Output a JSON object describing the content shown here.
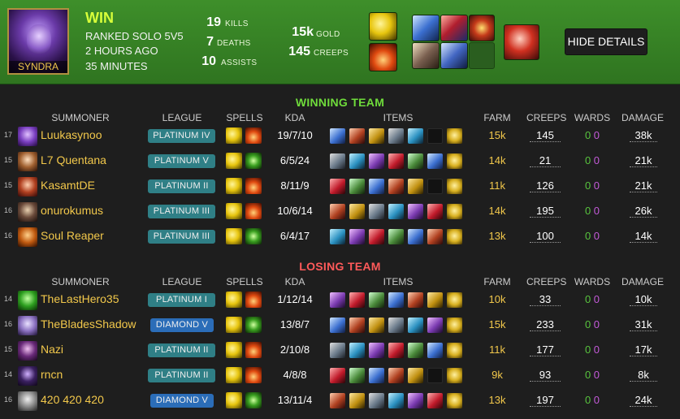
{
  "header": {
    "champion": "SYNDRA",
    "result": "WIN",
    "queue": "RANKED SOLO 5V5",
    "time_ago": "2 HOURS AGO",
    "duration": "35 MINUTES",
    "kills": "19",
    "kills_label": "KILLS",
    "deaths": "7",
    "deaths_label": "DEATHS",
    "assists": "10",
    "assists_label": "ASSISTS",
    "gold": "15k",
    "gold_label": "GOLD",
    "creeps": "145",
    "creeps_label": "CREEPS",
    "hide_details": "HIDE DETAILS",
    "spell_icons": [
      "flash-icon",
      "ignite-icon"
    ],
    "item_icons": [
      "mana-sword-icon",
      "bramble-icon",
      "boots-icon",
      "rod-icon",
      "staff-icon",
      "empty-slot"
    ],
    "trinket_icon": "ward-trinket-icon"
  },
  "columns": {
    "summoner": "SUMMONER",
    "league": "LEAGUE",
    "spells": "SPELLS",
    "kda": "KDA",
    "items": "ITEMS",
    "farm": "FARM",
    "creeps": "CREEPS",
    "wards": "WARDS",
    "damage": "DAMAGE"
  },
  "teams": {
    "winning_title": "WINNING TEAM",
    "losing_title": "LOSING TEAM"
  },
  "winning": [
    {
      "level": "17",
      "name": "Luukasynoo",
      "league": "PLATINUM IV",
      "kda": "19/7/10",
      "farm": "15k",
      "creeps": "145",
      "wards_a": "0",
      "wards_b": "0",
      "damage": "38k"
    },
    {
      "level": "15",
      "name": "L7 Quentana",
      "league": "PLATINUM V",
      "kda": "6/5/24",
      "farm": "14k",
      "creeps": "21",
      "wards_a": "0",
      "wards_b": "0",
      "damage": "21k"
    },
    {
      "level": "15",
      "name": "KasamtDE",
      "league": "PLATINUM II",
      "kda": "8/11/9",
      "farm": "11k",
      "creeps": "126",
      "wards_a": "0",
      "wards_b": "0",
      "damage": "21k"
    },
    {
      "level": "16",
      "name": "onurokumus",
      "league": "PLATINUM III",
      "kda": "10/6/14",
      "farm": "14k",
      "creeps": "195",
      "wards_a": "0",
      "wards_b": "0",
      "damage": "26k"
    },
    {
      "level": "16",
      "name": "Soul Reaper",
      "league": "PLATINUM III",
      "kda": "6/4/17",
      "farm": "13k",
      "creeps": "100",
      "wards_a": "0",
      "wards_b": "0",
      "damage": "14k"
    }
  ],
  "losing": [
    {
      "level": "14",
      "name": "TheLastHero35",
      "league": "PLATINUM I",
      "kda": "1/12/14",
      "farm": "10k",
      "creeps": "33",
      "wards_a": "0",
      "wards_b": "0",
      "damage": "10k"
    },
    {
      "level": "16",
      "name": "TheBladesShadow",
      "league": "DIAMOND V",
      "kda": "13/8/7",
      "farm": "15k",
      "creeps": "233",
      "wards_a": "0",
      "wards_b": "0",
      "damage": "31k"
    },
    {
      "level": "15",
      "name": "Nazi",
      "league": "PLATINUM II",
      "kda": "2/10/8",
      "farm": "11k",
      "creeps": "177",
      "wards_a": "0",
      "wards_b": "0",
      "damage": "17k"
    },
    {
      "level": "14",
      "name": "rncn",
      "league": "PLATINUM II",
      "kda": "4/8/8",
      "farm": "9k",
      "creeps": "93",
      "wards_a": "0",
      "wards_b": "0",
      "damage": "8k"
    },
    {
      "level": "16",
      "name": "420 420 420",
      "league": "DIAMOND V",
      "kda": "13/11/4",
      "farm": "13k",
      "creeps": "197",
      "wards_a": "0",
      "wards_b": "0",
      "damage": "24k"
    }
  ],
  "colors": {
    "header_green": "#3e8f2a",
    "win_text": "#d8ff3a",
    "winning_title": "#6fdc3b",
    "losing_title": "#ff5a5a",
    "name_gold": "#f2c84b",
    "platinum_badge": "#2f7f86",
    "diamond_badge": "#2b6db8"
  }
}
